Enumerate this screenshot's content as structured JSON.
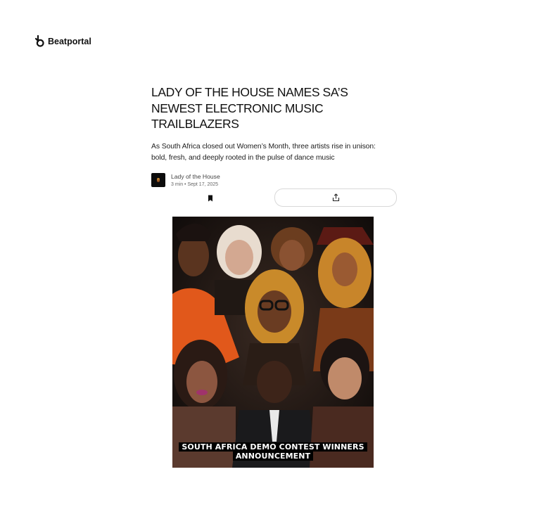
{
  "header": {
    "brand_name": "Beatportal",
    "brand_icon": "beatportal-logo-icon"
  },
  "article": {
    "headline_lines": [
      "LADY OF THE HOUSE NAMES SA’S",
      "NEWEST ELECTRONIC MUSIC",
      "TRAILBLAZERS"
    ],
    "subhead_lines": [
      "As South Africa closed out Women’s Month, three artists rise in unison:",
      "bold, fresh, and deeply rooted in the pulse of dance music"
    ],
    "author": "Lady of the House",
    "meta": "3 min • Sept 17, 2025"
  },
  "actions": {
    "bookmark_icon": "bookmark-icon",
    "share_icon": "share-icon"
  },
  "hero_image": {
    "caption_lines": [
      "SOUTH AFRICA DEMO CONTEST WINNERS",
      "ANNOUNCEMENT"
    ]
  },
  "colors": {
    "text": "#111111",
    "border": "#d8d8d8",
    "caption_bg": "#000000",
    "caption_text": "#ffffff"
  }
}
